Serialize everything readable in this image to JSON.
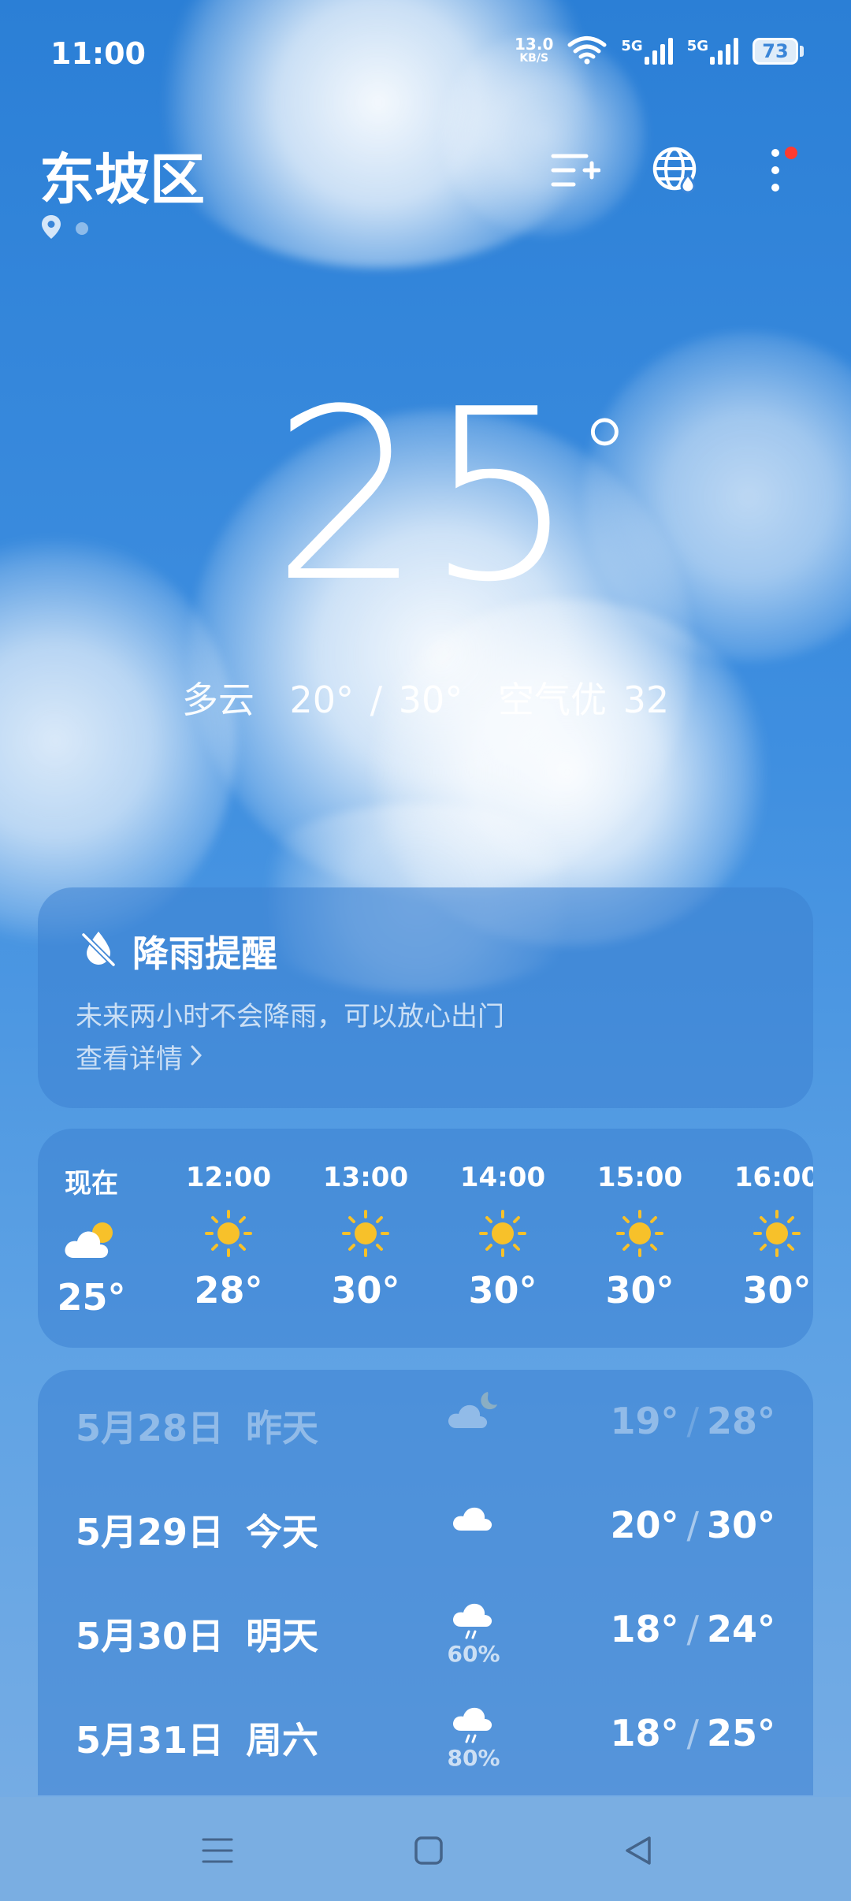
{
  "status": {
    "time": "11:00",
    "net_speed_value": "13.0",
    "net_speed_unit": "KB/S",
    "sim1_label": "5G",
    "sim2_label": "5G",
    "battery": "73"
  },
  "header": {
    "city": "东坡区",
    "page_count": 2
  },
  "current": {
    "temp": "25",
    "degree": "°",
    "condition": "多云",
    "range": "20° / 30°",
    "aqi": "空气优 32"
  },
  "rain_alert": {
    "title": "降雨提醒",
    "message": "未来两小时不会降雨，可以放心出门",
    "link": "查看详情"
  },
  "hourly": [
    {
      "label": "现在",
      "icon": "partly-cloudy-icon",
      "temp": "25°"
    },
    {
      "label": "12:00",
      "icon": "sun-icon",
      "temp": "28°"
    },
    {
      "label": "13:00",
      "icon": "sun-icon",
      "temp": "30°"
    },
    {
      "label": "14:00",
      "icon": "sun-icon",
      "temp": "30°"
    },
    {
      "label": "15:00",
      "icon": "sun-icon",
      "temp": "30°"
    },
    {
      "label": "16:00",
      "icon": "sun-icon",
      "temp": "30°"
    }
  ],
  "daily": [
    {
      "date": "5月28日",
      "day": "昨天",
      "icon": "cloud-moon-icon",
      "precip": "",
      "low": "19°",
      "high": "28°"
    },
    {
      "date": "5月29日",
      "day": "今天",
      "icon": "cloud-icon",
      "precip": "",
      "low": "20°",
      "high": "30°"
    },
    {
      "date": "5月30日",
      "day": "明天",
      "icon": "rain-icon",
      "precip": "60%",
      "low": "18°",
      "high": "24°"
    },
    {
      "date": "5月31日",
      "day": "周六",
      "icon": "rain-icon",
      "precip": "80%",
      "low": "18°",
      "high": "25°"
    }
  ],
  "colors": {
    "sky_top": "#2b7fd6",
    "sky_bottom": "#7aaee4",
    "sun": "#f7c12a",
    "notification": "#ff3b30"
  }
}
